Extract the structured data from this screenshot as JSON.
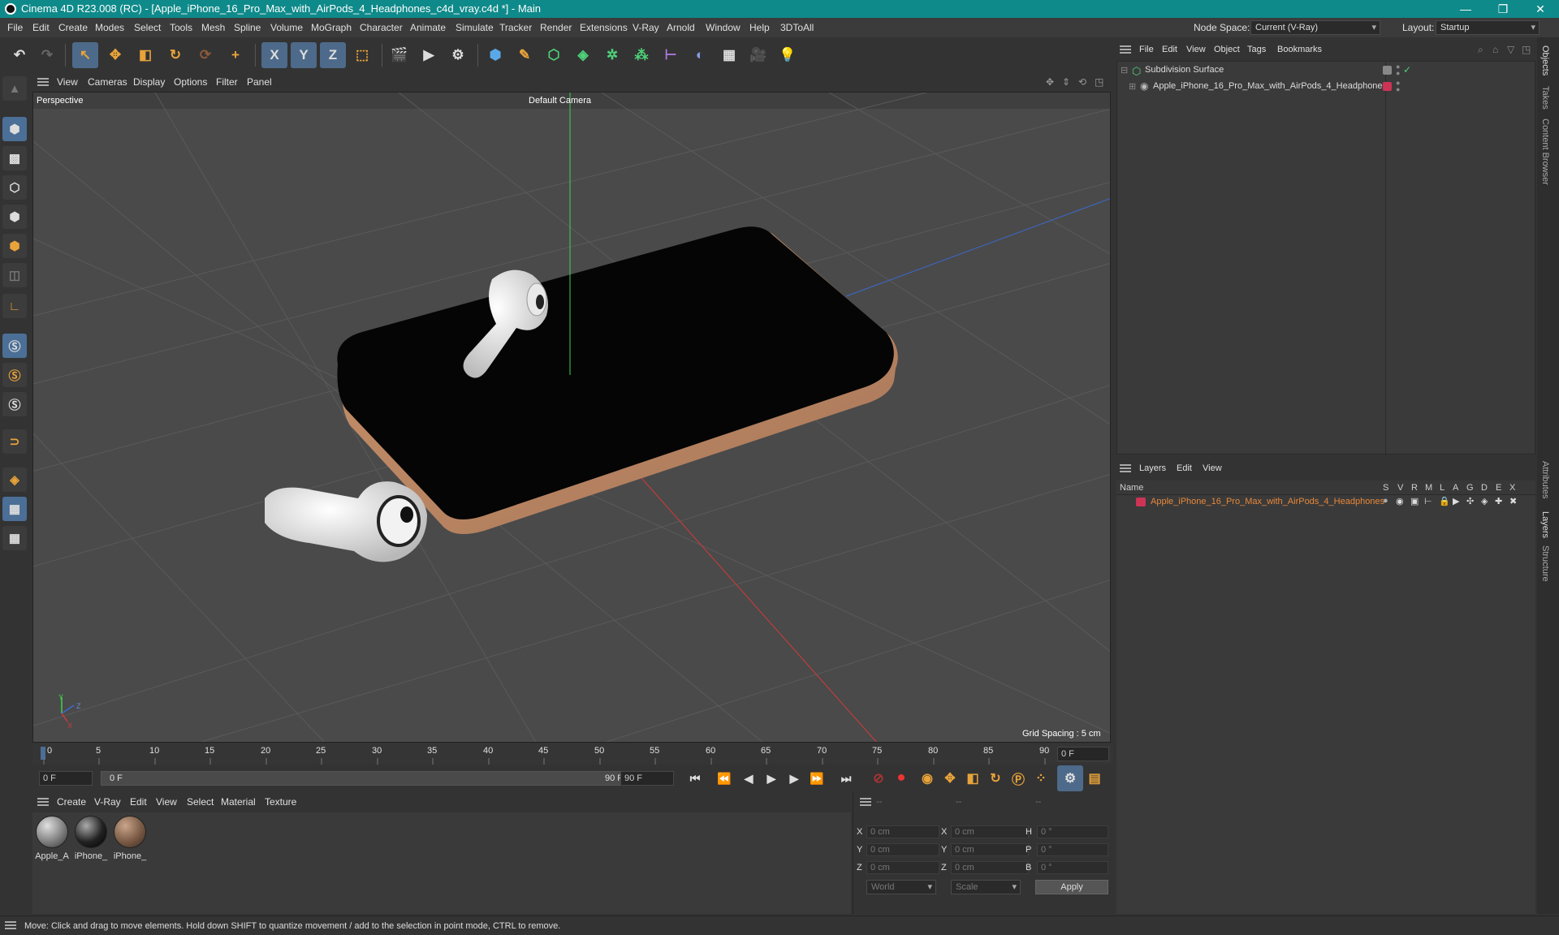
{
  "window": {
    "title": "Cinema 4D R23.008 (RC) - [Apple_iPhone_16_Pro_Max_with_AirPods_4_Headphones_c4d_vray.c4d *] - Main",
    "controls": [
      "—",
      "❐",
      "✕"
    ]
  },
  "menubar": {
    "items": [
      "File",
      "Edit",
      "Create",
      "Modes",
      "Select",
      "Tools",
      "Mesh",
      "Spline",
      "Volume",
      "MoGraph",
      "Character",
      "Animate",
      "Simulate",
      "Tracker",
      "Render",
      "Extensions",
      "V-Ray",
      "Arnold",
      "Window",
      "Help",
      "3DToAll"
    ],
    "node_space_label": "Node Space:",
    "node_space_value": "Current (V-Ray)",
    "layout_label": "Layout:",
    "layout_value": "Startup"
  },
  "toolbar": {
    "axis_x": "X",
    "axis_y": "Y",
    "axis_z": "Z"
  },
  "viewport": {
    "menu": [
      "View",
      "Cameras",
      "Display",
      "Options",
      "Filter",
      "Panel"
    ],
    "label": "Perspective",
    "camera": "Default Camera",
    "grid_spacing": "Grid Spacing : 5 cm",
    "axis_labels": {
      "y": "Y",
      "z": "Z",
      "x": "X"
    }
  },
  "timeline": {
    "ticks": [
      "0",
      "5",
      "10",
      "15",
      "20",
      "25",
      "30",
      "35",
      "40",
      "45",
      "50",
      "55",
      "60",
      "65",
      "70",
      "75",
      "80",
      "85",
      "90"
    ],
    "current_frame": "0 F",
    "start_frame": "0 F",
    "range_start": "0 F",
    "range_end": "90 F",
    "end_frame": "90 F"
  },
  "materials": {
    "menu": [
      "Create",
      "V-Ray",
      "Edit",
      "View",
      "Select",
      "Material",
      "Texture"
    ],
    "items": [
      {
        "label": "Apple_A",
        "color": "#8c8c8c"
      },
      {
        "label": "iPhone_",
        "color": "#2b2b2b"
      },
      {
        "label": "iPhone_",
        "color": "#7a5a45"
      }
    ]
  },
  "coordinates": {
    "header": [
      "--",
      "--",
      "--"
    ],
    "rows": [
      {
        "a": "X",
        "v1": "0 cm",
        "b": "X",
        "v2": "0 cm",
        "c": "H",
        "v3": "0 °"
      },
      {
        "a": "Y",
        "v1": "0 cm",
        "b": "Y",
        "v2": "0 cm",
        "c": "P",
        "v3": "0 °"
      },
      {
        "a": "Z",
        "v1": "0 cm",
        "b": "Z",
        "v2": "0 cm",
        "c": "B",
        "v3": "0 °"
      }
    ],
    "mode_world": "World",
    "mode_scale": "Scale",
    "apply": "Apply"
  },
  "objects": {
    "menu": [
      "File",
      "Edit",
      "View",
      "Object",
      "Tags",
      "Bookmarks"
    ],
    "items": [
      {
        "name": "Subdivision Surface"
      },
      {
        "name": "Apple_iPhone_16_Pro_Max_with_AirPods_4_Headphones"
      }
    ]
  },
  "layers": {
    "menu": [
      "Layers",
      "Edit",
      "View"
    ],
    "name_header": "Name",
    "flags": [
      "S",
      "V",
      "R",
      "M",
      "L",
      "A",
      "G",
      "D",
      "E",
      "X"
    ],
    "items": [
      {
        "name": "Apple_iPhone_16_Pro_Max_with_AirPods_4_Headphones",
        "color": "#cc3355"
      }
    ]
  },
  "side_tabs": [
    "Objects",
    "Takes",
    "Content Browser",
    "Attributes",
    "Layers",
    "Structure"
  ],
  "status": "Move: Click and drag to move elements. Hold down SHIFT to quantize movement / add to the selection in point mode, CTRL to remove.",
  "colors": {
    "titlebar": "#0f8a8a",
    "accent": "#4d6a8a",
    "layer_text": "#e8883a"
  }
}
